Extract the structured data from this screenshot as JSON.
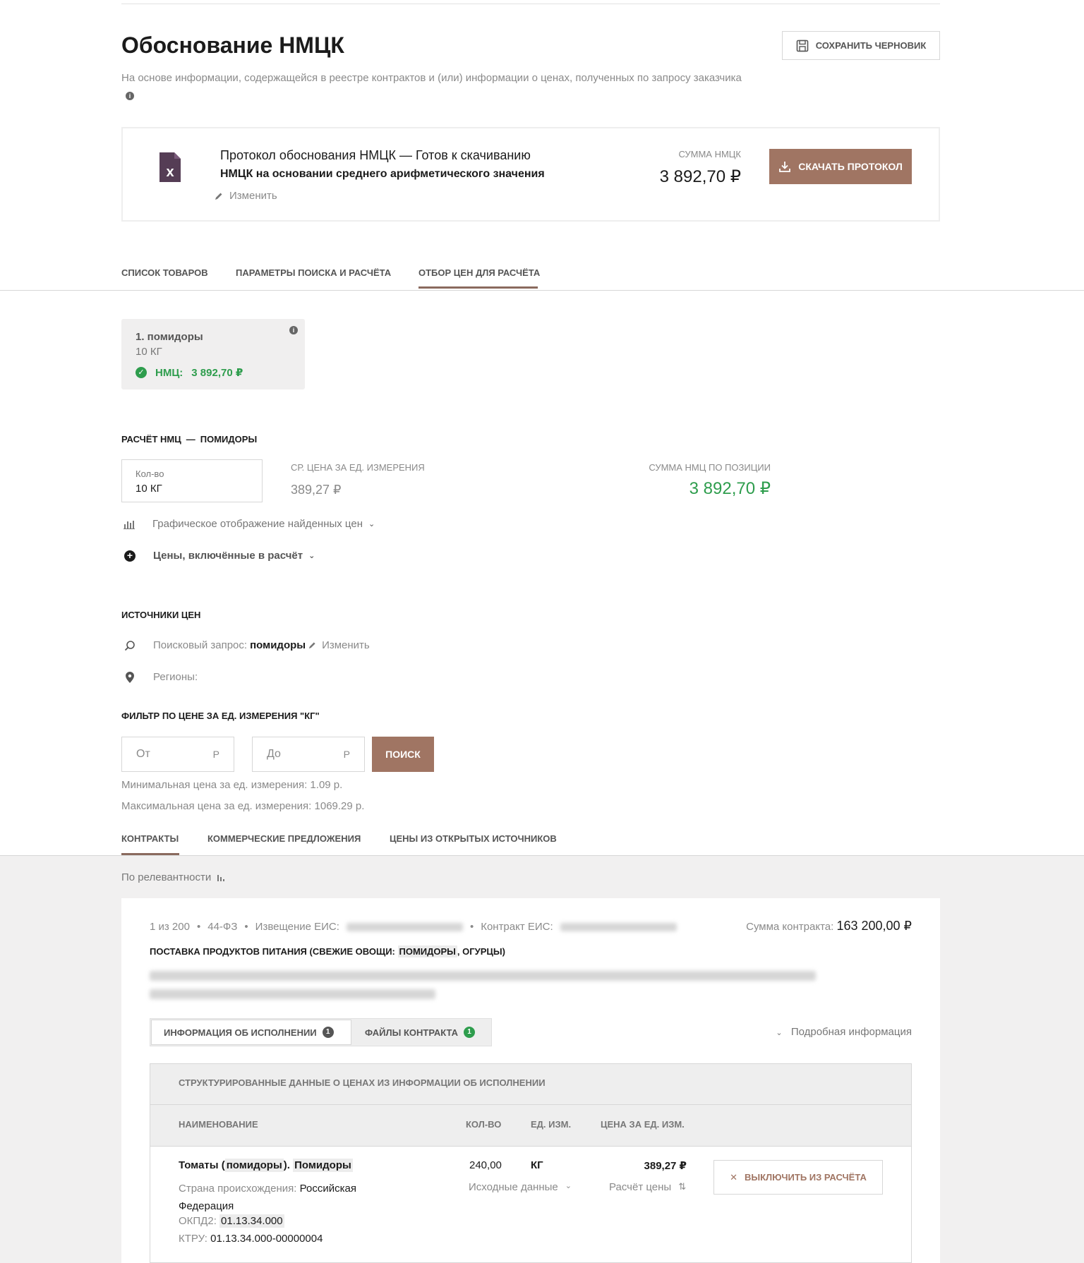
{
  "header": {
    "title": "Обоснование НМЦК",
    "subtitle": "На основе информации, содержащейся в реестре контрактов и (или) информации о ценах, полученных по запросу заказчика",
    "info_glyph": "i",
    "save_draft_label": "Сохранить черновик"
  },
  "protocol": {
    "file_icon": "excel-file-icon",
    "title": "Протокол обоснования НМЦК — Готов к скачиванию",
    "subtitle": "НМЦК на основании среднего арифметического значения",
    "edit_label": "Изменить",
    "nmck_label": "Сумма НМЦК",
    "nmck_value": "3 892,70 ₽",
    "download_label": "Скачать протокол"
  },
  "tabs": [
    {
      "label": "Список товаров",
      "active": false
    },
    {
      "label": "Параметры поиска и расчёта",
      "active": false
    },
    {
      "label": "Отбор цен для расчёта",
      "active": true
    }
  ],
  "item_card": {
    "title": "1. помидоры",
    "qty": "10 КГ",
    "nmc_label": "НМЦ:",
    "nmc_value": "3 892,70 ₽",
    "check_glyph": "✓",
    "info_glyph": "i"
  },
  "calc": {
    "heading_prefix": "Расчёт НМЦ",
    "heading_dash": "—",
    "heading_item": "помидоры",
    "qty_label": "Кол-во",
    "qty_value": "10 КГ",
    "avg_label": "Ср. цена за ед. измерения",
    "avg_value": "389,27 ₽",
    "sum_label": "Сумма НМЦ по позиции",
    "sum_value": "3 892,70 ₽",
    "graph_label": "Графическое отображение найденных цен",
    "included_label": "Цены, включённые в расчёт",
    "plus_glyph": "+",
    "chevron_glyph": "⌄"
  },
  "sources": {
    "heading": "Источники цен",
    "query_label": "Поисковый запрос:",
    "query_value": "помидоры",
    "edit_label": "Изменить",
    "regions_label": "Регионы:"
  },
  "filter": {
    "heading": "Фильтр по цене за ед. измерения \"кг\"",
    "from_placeholder": "От",
    "to_placeholder": "До",
    "currency_suffix": "Р",
    "search_label": "Поиск",
    "min_note": "Минимальная цена за ед. измерения: 1.09 р.",
    "max_note": "Максимальная цена за ед. измерения: 1069.29 р."
  },
  "source_tabs": [
    {
      "label": "Контракты",
      "active": true
    },
    {
      "label": "Коммерческие предложения",
      "active": false
    },
    {
      "label": "Цены из открытых источников",
      "active": false
    }
  ],
  "sort": {
    "label": "По релевантности"
  },
  "contract": {
    "position": "1 из 200",
    "law": "44-ФЗ",
    "notice_label": "Извещение ЕИС:",
    "contract_label": "Контракт ЕИС:",
    "sum_label": "Сумма контракта:",
    "sum_value": "163 200,00 ₽",
    "title_start": "Поставка продуктов питания (свежие овощи: ",
    "title_hl": "помидоры",
    "title_end": ", огурцы)",
    "seg_tabs": [
      {
        "label": "Информация об исполнении",
        "count": "1",
        "active": true
      },
      {
        "label": "Файлы контракта",
        "count": "1",
        "active": false
      }
    ],
    "detail_label": "Подробная информация",
    "chevron_glyph": "⌄"
  },
  "table": {
    "caption": "Структурированные данные о ценах из информации об исполнении",
    "headers": {
      "name": "Наименование",
      "qty": "Кол-во",
      "unit": "Ед. изм.",
      "price": "Цена за ед. изм."
    },
    "row": {
      "name_a": "Томаты (",
      "name_b": "помидоры",
      "name_c": "). ",
      "name_d": "Помидоры",
      "origin_label": "Страна происхождения:",
      "origin_value": "Российская Федерация",
      "okpd_label": "ОКПД2:",
      "okpd_value": "01.13.34.000",
      "ktru_label": "КТРУ:",
      "ktru_value": "01.13.34.000-00000004",
      "qty": "240,00",
      "unit": "КГ",
      "price": "389,27 ₽",
      "source_data_label": "Исходные данные",
      "price_calc_label": "Расчёт цены",
      "sort_glyph": "⇅",
      "exclude_label": "Выключить из расчёта",
      "close_glyph": "✕"
    }
  }
}
